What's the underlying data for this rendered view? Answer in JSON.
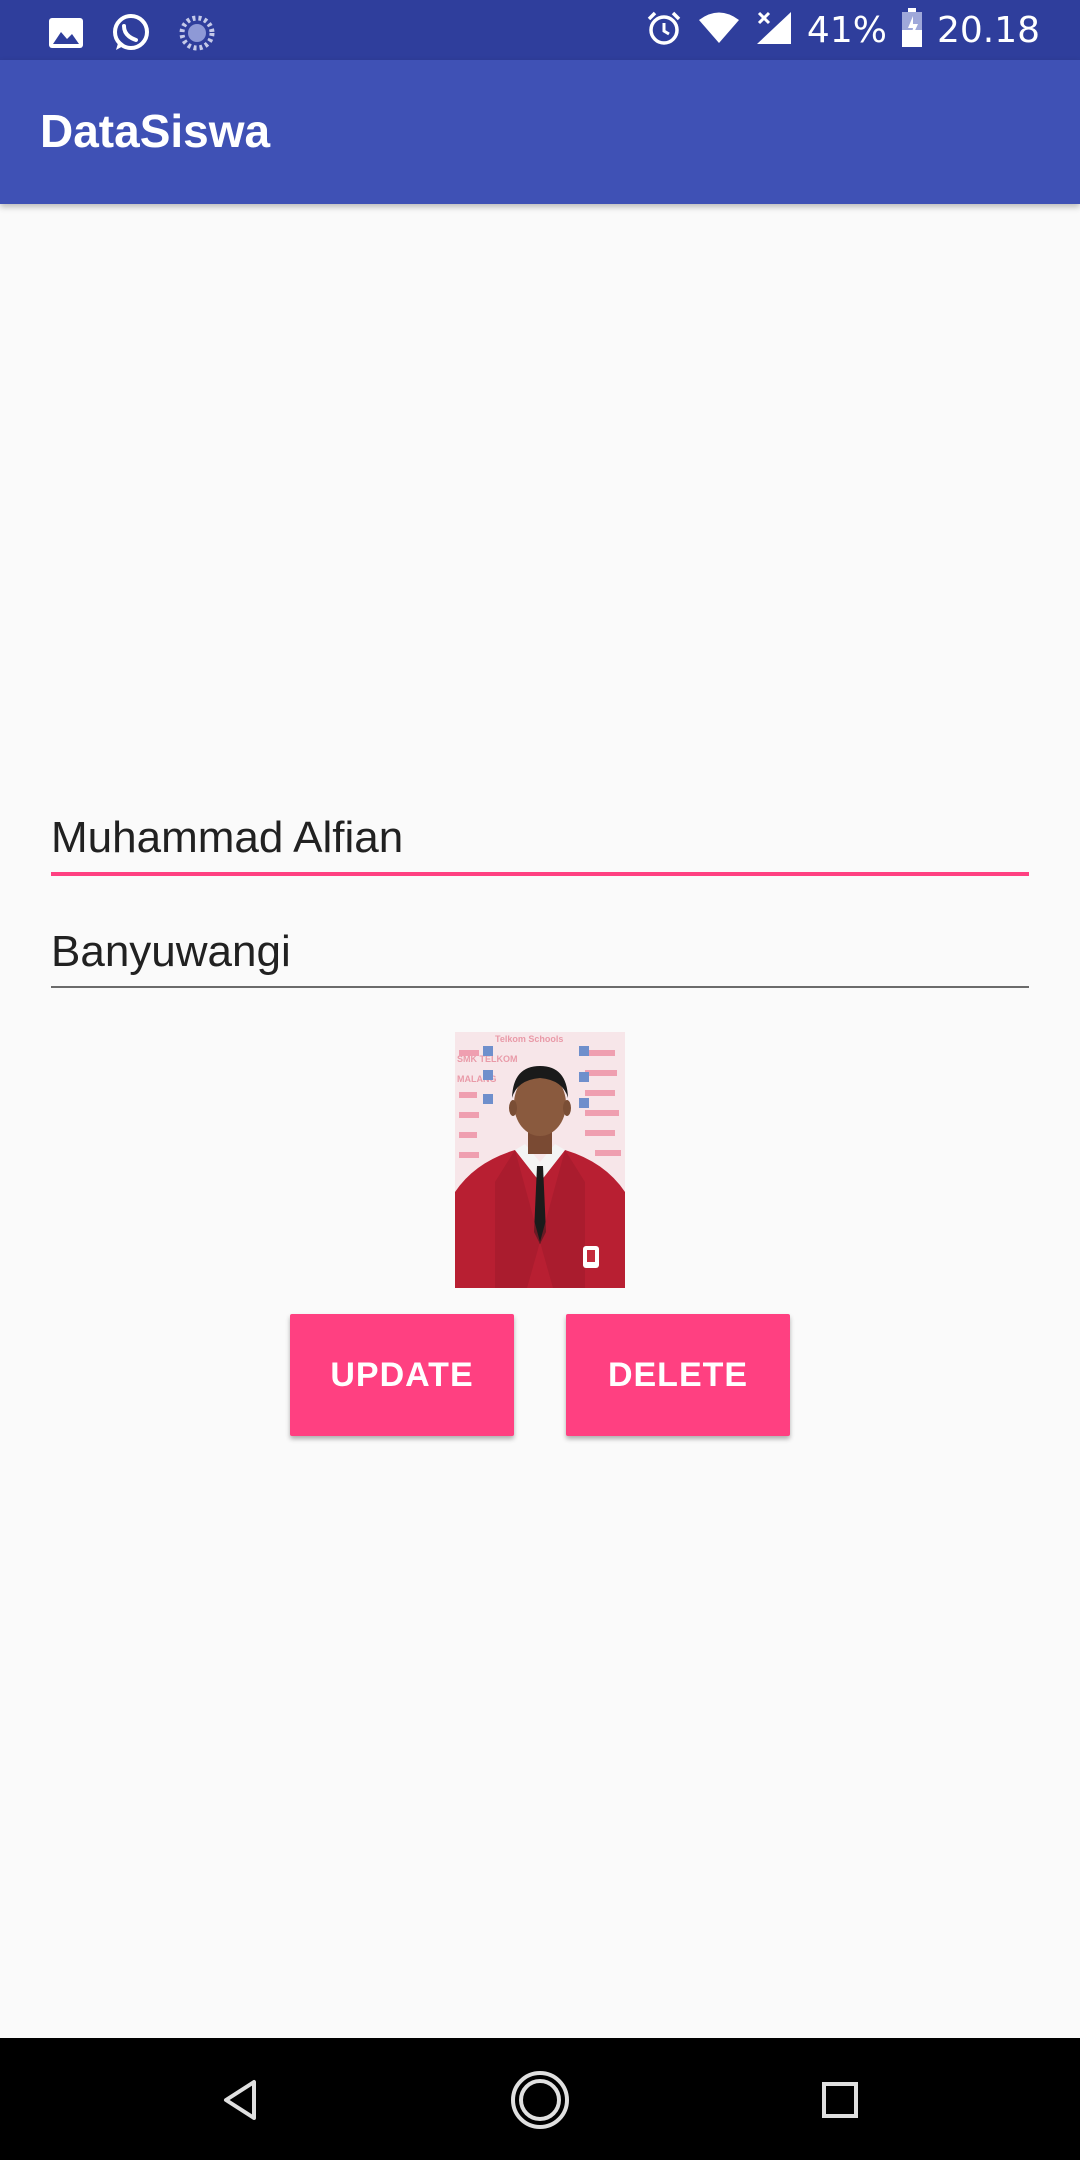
{
  "status_bar": {
    "battery_percent": "41%",
    "time": "20.18",
    "icons": [
      "image-icon",
      "whatsapp-icon",
      "sync-icon",
      "alarm-icon",
      "wifi-icon",
      "no-signal-icon",
      "battery-icon"
    ]
  },
  "app_bar": {
    "title": "DataSiswa"
  },
  "form": {
    "name_value": "Muhammad Alfian",
    "city_value": "Banyuwangi",
    "photo": {
      "bg_texts": [
        "Telkom Schools",
        "SMK TELKOM",
        "MALANG"
      ]
    }
  },
  "buttons": {
    "update_label": "UPDATE",
    "delete_label": "DELETE"
  },
  "colors": {
    "status_bar": "#2f3e9c",
    "app_bar": "#3f51b5",
    "accent": "#ff4081",
    "background": "#fafafa"
  },
  "nav_bar": {
    "icons": [
      "back-icon",
      "home-icon",
      "recents-icon"
    ]
  }
}
